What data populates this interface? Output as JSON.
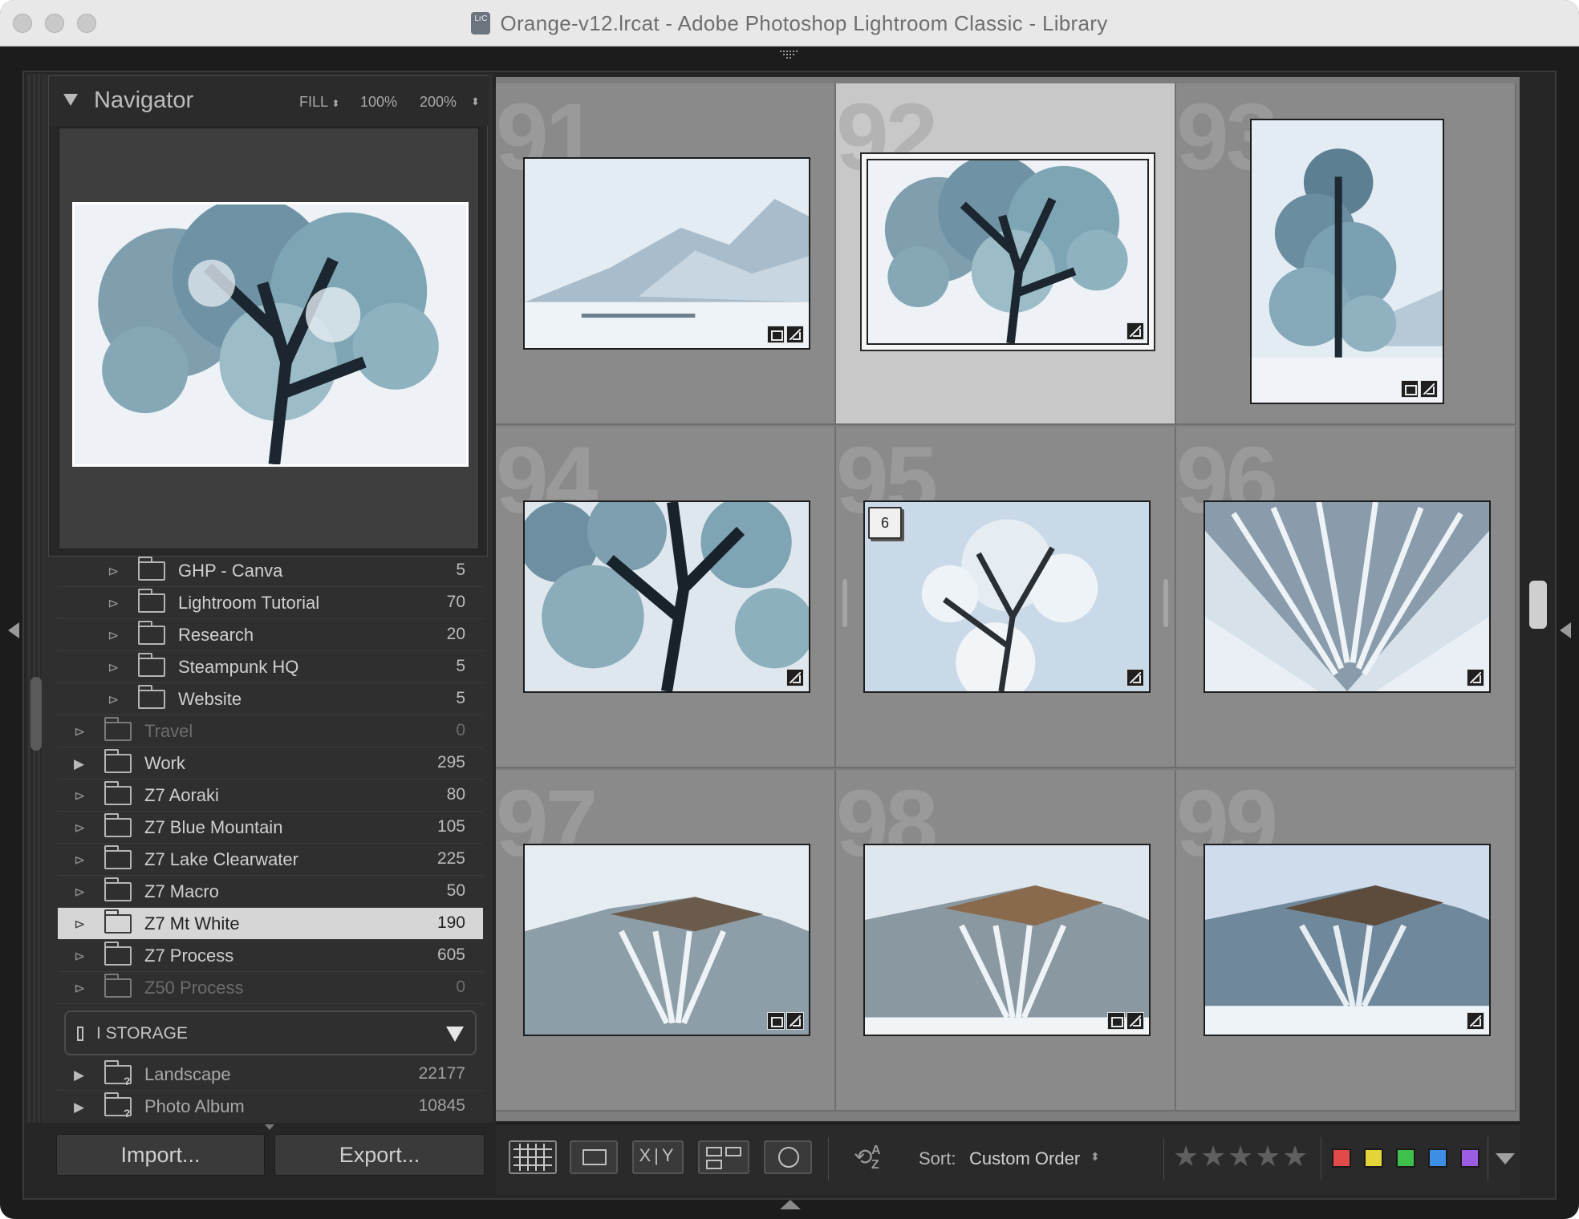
{
  "window": {
    "title": "Orange-v12.lrcat - Adobe Photoshop Lightroom Classic - Library",
    "app_icon_text": "LrC"
  },
  "navigator": {
    "title": "Navigator",
    "zoom_fill": "FILL",
    "zoom_100": "100%",
    "zoom_200": "200%"
  },
  "folders": [
    {
      "name": "GHP - Canva",
      "count": "5"
    },
    {
      "name": "Lightroom Tutorial",
      "count": "70"
    },
    {
      "name": "Research",
      "count": "20"
    },
    {
      "name": "Steampunk HQ",
      "count": "5"
    },
    {
      "name": "Website",
      "count": "5"
    },
    {
      "name": "Travel",
      "count": "0"
    },
    {
      "name": "Work",
      "count": "295"
    },
    {
      "name": "Z7 Aoraki",
      "count": "80"
    },
    {
      "name": "Z7 Blue Mountain",
      "count": "105"
    },
    {
      "name": "Z7 Lake Clearwater",
      "count": "225"
    },
    {
      "name": "Z7 Macro",
      "count": "50"
    },
    {
      "name": "Z7 Mt White",
      "count": "190"
    },
    {
      "name": "Z7 Process",
      "count": "605"
    },
    {
      "name": "Z50 Process",
      "count": "0"
    }
  ],
  "volume": {
    "name": "I STORAGE"
  },
  "offline_folders": [
    {
      "name": "Landscape",
      "count": "22177"
    },
    {
      "name": "Photo Album",
      "count": "10845"
    }
  ],
  "buttons": {
    "import": "Import...",
    "export": "Export..."
  },
  "grid": {
    "cells": [
      {
        "index": "91"
      },
      {
        "index": "92"
      },
      {
        "index": "93"
      },
      {
        "index": "94"
      },
      {
        "index": "95",
        "stack_count": "6"
      },
      {
        "index": "96"
      },
      {
        "index": "97"
      },
      {
        "index": "98"
      },
      {
        "index": "99"
      }
    ]
  },
  "toolbar": {
    "sort_label": "Sort:",
    "sort_value": "Custom Order",
    "sort_az": "A Z",
    "xy_label": "X|Y",
    "stars": [
      "★",
      "★",
      "★",
      "★",
      "★"
    ],
    "label_colors": [
      "#e24a4a",
      "#e3d43a",
      "#3fbf4c",
      "#3f8ee6",
      "#9d5de2"
    ]
  }
}
